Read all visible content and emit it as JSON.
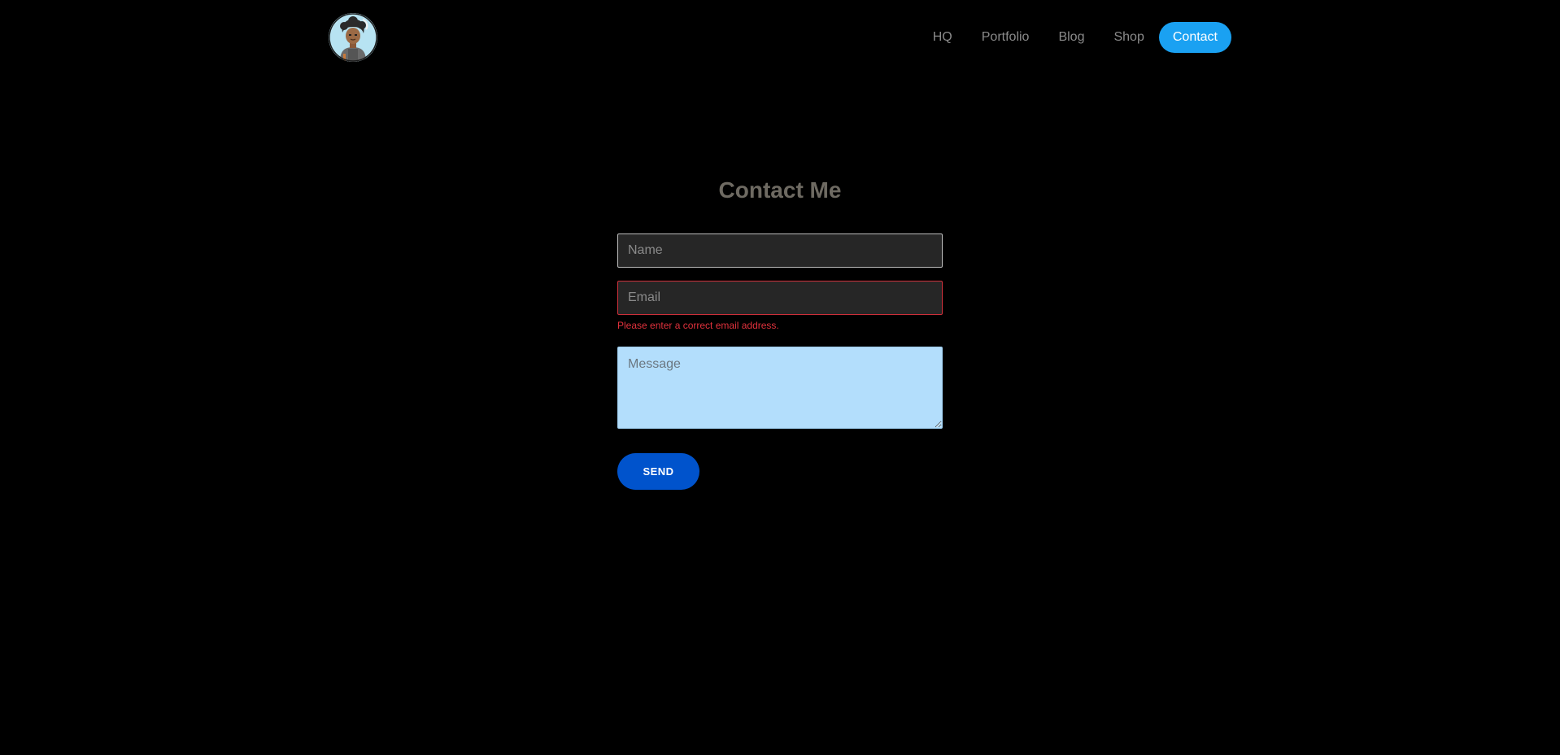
{
  "header": {
    "logo_icon": "avatar-logo-icon",
    "nav": [
      {
        "label": "HQ"
      },
      {
        "label": "Portfolio"
      },
      {
        "label": "Blog"
      },
      {
        "label": "Shop"
      },
      {
        "label": "Contact",
        "active": true
      }
    ]
  },
  "contact": {
    "title": "Contact Me",
    "name_placeholder": "Name",
    "email_placeholder": "Email",
    "email_error": "Please enter a correct email address.",
    "message_placeholder": "Message",
    "send_label": "SEND"
  },
  "colors": {
    "background": "#000000",
    "nav_active": "#1aa1f2",
    "error": "#e0313c",
    "send_button": "#0053cc",
    "message_bg": "#b3defc"
  }
}
